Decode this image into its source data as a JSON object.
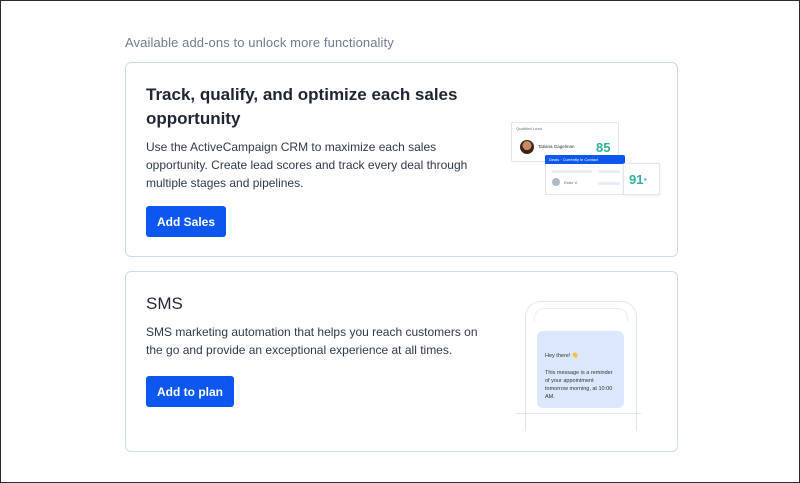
{
  "section": {
    "title": "Available add-ons to unlock more functionality"
  },
  "sales": {
    "title": "Track, qualify, and optimize each sales opportunity",
    "description": "Use the ActiveCampaign CRM to maximize each sales opportunity. Create lead scores and track every deal through multiple stages and pipelines.",
    "button": "Add Sales",
    "illustration": {
      "lead_label": "Qualified Lead",
      "lead_name": "Tatiana Gagelman",
      "lead_score": "85",
      "deal_header": "Deals · Currently in Contact",
      "deal_name": "Ester V.",
      "deal_score": "91·"
    }
  },
  "sms": {
    "title": "SMS",
    "description": "SMS marketing automation that helps you reach customers on the go and provide an exceptional experience at all times.",
    "button": "Add to plan",
    "illustration": {
      "greeting": "Hey there! 👋",
      "message": "This message is a reminder of your appointment tomorrow morning, at 10:00 AM."
    }
  },
  "colors": {
    "accent": "#0b57f0",
    "score": "#2cb1a0",
    "card_border": "#c9dcf2",
    "bubble": "#dbe8fb"
  }
}
